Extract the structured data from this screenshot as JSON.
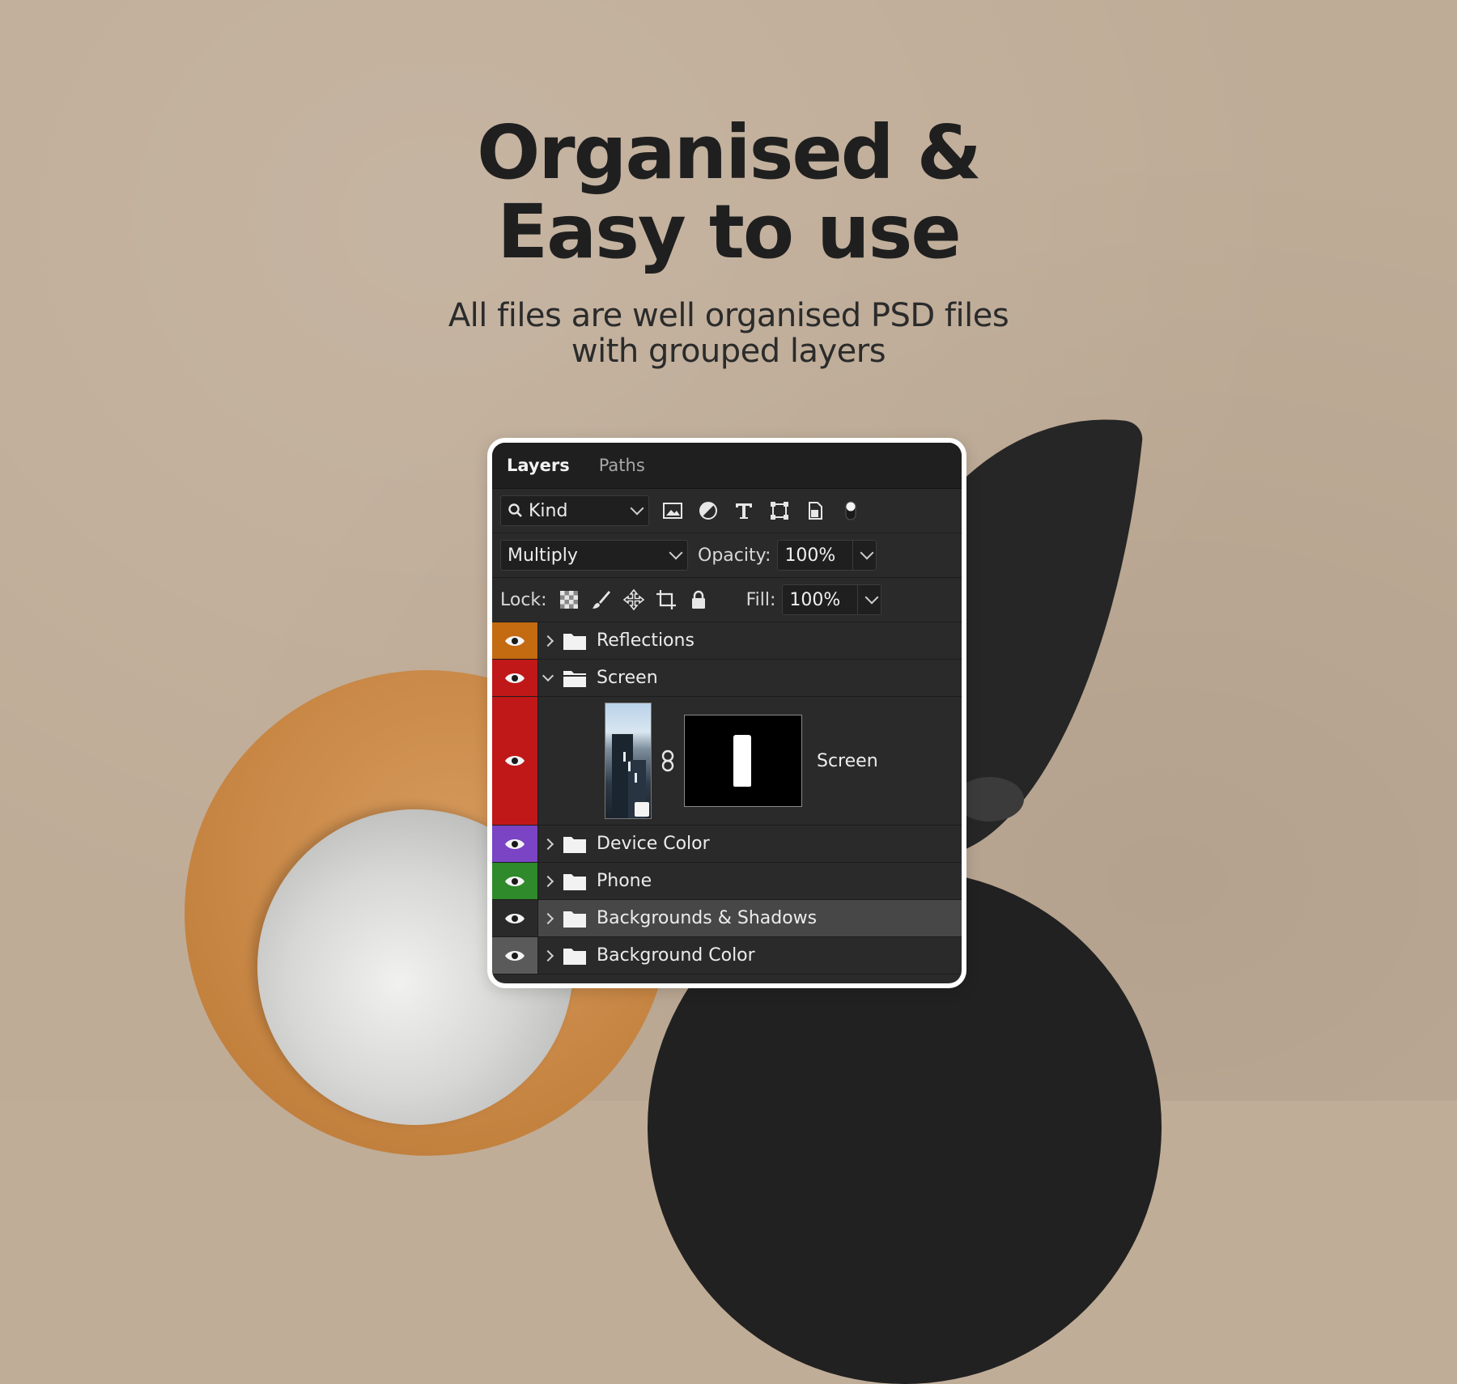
{
  "hero": {
    "headline_line1": "Organised &",
    "headline_line2": "Easy to use",
    "subtitle_line1": "All files are well organised PSD files",
    "subtitle_line2": "with grouped layers"
  },
  "panel": {
    "tabs": [
      {
        "label": "Layers",
        "active": true
      },
      {
        "label": "Paths",
        "active": false
      }
    ],
    "filter": {
      "label": "Kind"
    },
    "filter_icons": [
      "image-filter-icon",
      "adjustment-filter-icon",
      "type-filter-icon",
      "shape-filter-icon",
      "smart-object-filter-icon",
      "filter-toggle-icon"
    ],
    "blend_mode": "Multiply",
    "opacity_label": "Opacity:",
    "opacity_value": "100%",
    "lock_label": "Lock:",
    "lock_icons": [
      "lock-transparent-icon",
      "lock-image-icon",
      "lock-position-icon",
      "lock-artboard-icon",
      "lock-all-icon"
    ],
    "fill_label": "Fill:",
    "fill_value": "100%",
    "layers": [
      {
        "name": "Reflections",
        "color": "#c46a10",
        "expanded": false,
        "selected": false
      },
      {
        "name": "Screen",
        "color": "#c01818",
        "expanded": true,
        "selected": false
      },
      {
        "name": "Device Color",
        "color": "#7a44c4",
        "expanded": false,
        "selected": false
      },
      {
        "name": "Phone",
        "color": "#2e8a2a",
        "expanded": false,
        "selected": false
      },
      {
        "name": "Backgrounds & Shadows",
        "color": "#474747",
        "expanded": false,
        "selected": true
      },
      {
        "name": "Background Color",
        "color": "#5a5a5a",
        "expanded": false,
        "selected": false
      }
    ],
    "child_layer": {
      "name": "Screen",
      "color": "#c01818"
    }
  }
}
